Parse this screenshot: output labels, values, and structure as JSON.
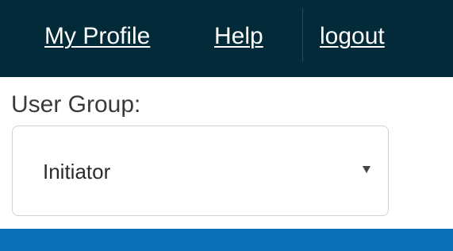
{
  "header": {
    "links": {
      "my_profile": "My Profile",
      "help": "Help",
      "logout": "logout"
    }
  },
  "user_group": {
    "label": "User Group:",
    "selected": "Initiator"
  },
  "colors": {
    "header_bg": "#022a38",
    "accent_bar": "#0a72b8"
  }
}
